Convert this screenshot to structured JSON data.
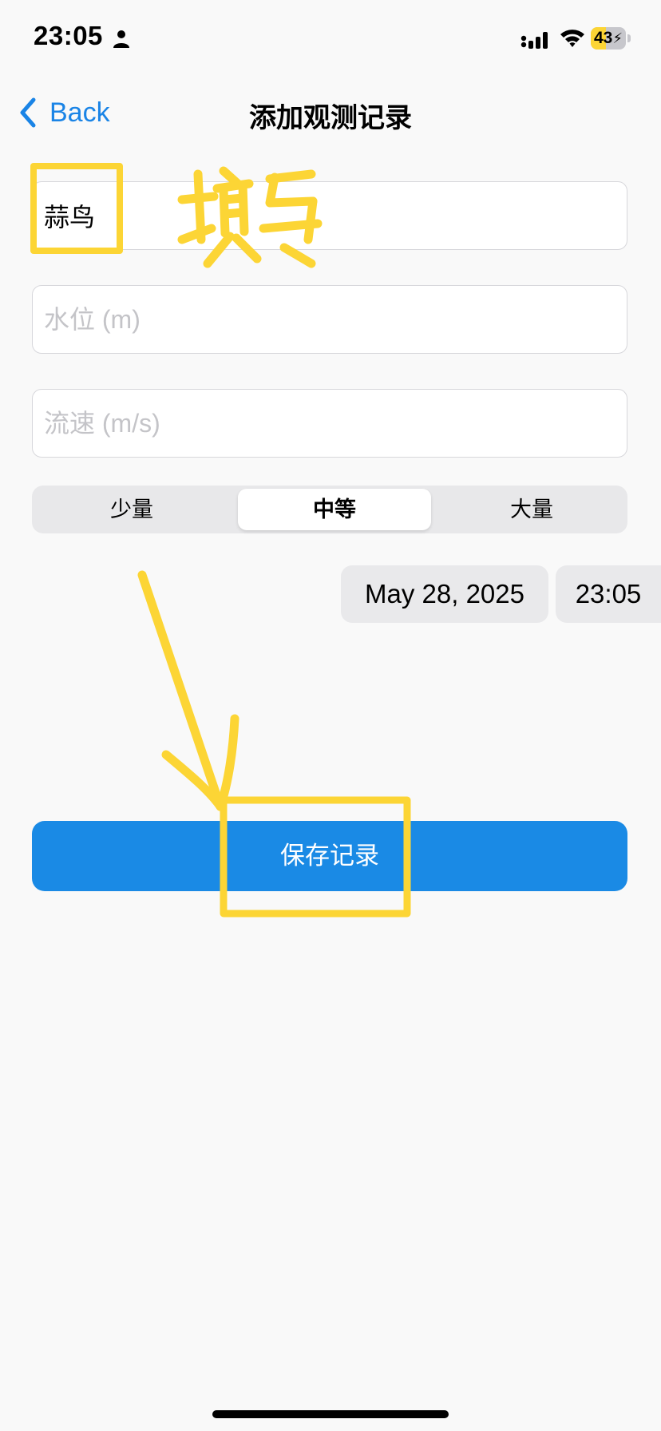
{
  "status_bar": {
    "time": "23:05",
    "battery_level": "43",
    "battery_fraction": 0.43
  },
  "nav": {
    "back_label": "Back",
    "title": "添加观测记录"
  },
  "form": {
    "species": {
      "value": "蒜鸟",
      "placeholder": ""
    },
    "water_level": {
      "value": "",
      "placeholder": "水位 (m)"
    },
    "flow_speed": {
      "value": "",
      "placeholder": "流速 (m/s)"
    },
    "quantity": {
      "options": [
        "少量",
        "中等",
        "大量"
      ],
      "selected": "中等"
    },
    "date": "May 28, 2025",
    "time": "23:05"
  },
  "save_label": "保存记录",
  "icons": {
    "person": "person-icon",
    "signal": "cellular-signal-icon",
    "wifi": "wifi-icon",
    "battery": "battery-icon",
    "back": "chevron-left-icon"
  },
  "colors": {
    "accent": "#1a84e6",
    "save_button": "#1a8ae5",
    "annotation": "#fcd535",
    "battery_fill": "#fcd535"
  }
}
